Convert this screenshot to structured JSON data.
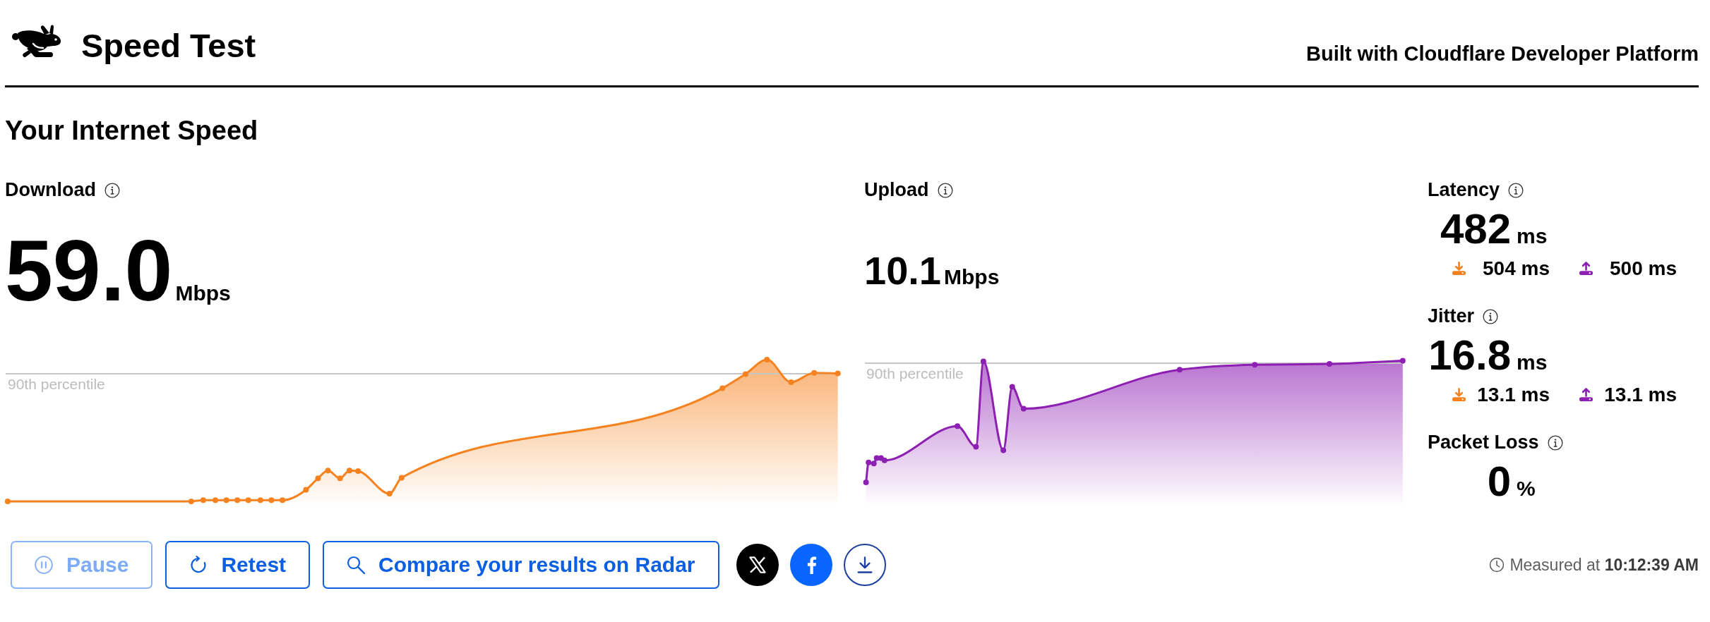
{
  "header": {
    "title": "Speed Test",
    "tagline": "Built with Cloudflare Developer Platform"
  },
  "heading": "Your Internet Speed",
  "download": {
    "label": "Download",
    "value": "59.0",
    "unit": "Mbps",
    "percentile_label": "90th percentile"
  },
  "upload": {
    "label": "Upload",
    "value": "10.1",
    "unit": "Mbps",
    "percentile_label": "90th percentile"
  },
  "metrics": [
    {
      "label": "Latency",
      "value": "482",
      "unit": "ms",
      "details": [
        {
          "kind": "download",
          "value": "504 ms"
        },
        {
          "kind": "upload",
          "value": "500 ms"
        }
      ]
    },
    {
      "label": "Jitter",
      "value": "16.8",
      "unit": "ms",
      "details": [
        {
          "kind": "download",
          "value": "13.1 ms"
        },
        {
          "kind": "upload",
          "value": "13.1 ms"
        }
      ]
    },
    {
      "label": "Packet Loss",
      "value": "0",
      "unit": "%"
    }
  ],
  "actions": [
    {
      "kind": "pause",
      "label": "Pause",
      "disabled": true
    },
    {
      "kind": "retest",
      "label": "Retest",
      "disabled": false
    },
    {
      "kind": "search",
      "label": "Compare your results on Radar",
      "disabled": false
    }
  ],
  "share": [
    {
      "kind": "x-logo"
    },
    {
      "kind": "f-logo"
    },
    {
      "kind": "download"
    }
  ],
  "measured": "Measured at **10:12:39 AM**"
}
